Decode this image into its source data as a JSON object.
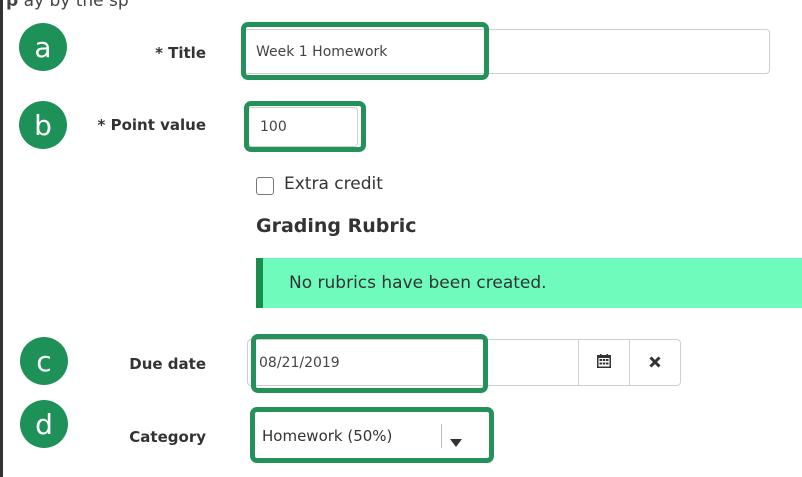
{
  "header_fragment": {
    "lead": "p",
    "rest": "                                      ay by the sp"
  },
  "callouts": [
    "a",
    "b",
    "c",
    "d"
  ],
  "title_field": {
    "label": "* Title",
    "value": "Week 1 Homework"
  },
  "points_field": {
    "label": "* Point value",
    "value": "100"
  },
  "extra_credit": {
    "label": "Extra credit",
    "checked": false
  },
  "rubric": {
    "heading": "Grading Rubric",
    "empty_message": "No rubrics have been created."
  },
  "due_date": {
    "label": "Due date",
    "value": "08/21/2019",
    "calendar_icon": "calendar-icon",
    "clear_icon": "close-icon"
  },
  "category": {
    "label": "Category",
    "selected": "Homework (50%)",
    "caret_icon": "caret-down-icon"
  },
  "colors": {
    "callout": "#25915a",
    "badge": "#1d9157",
    "alert_bg": "#6ffbbc",
    "alert_border": "#1a8c4c"
  }
}
